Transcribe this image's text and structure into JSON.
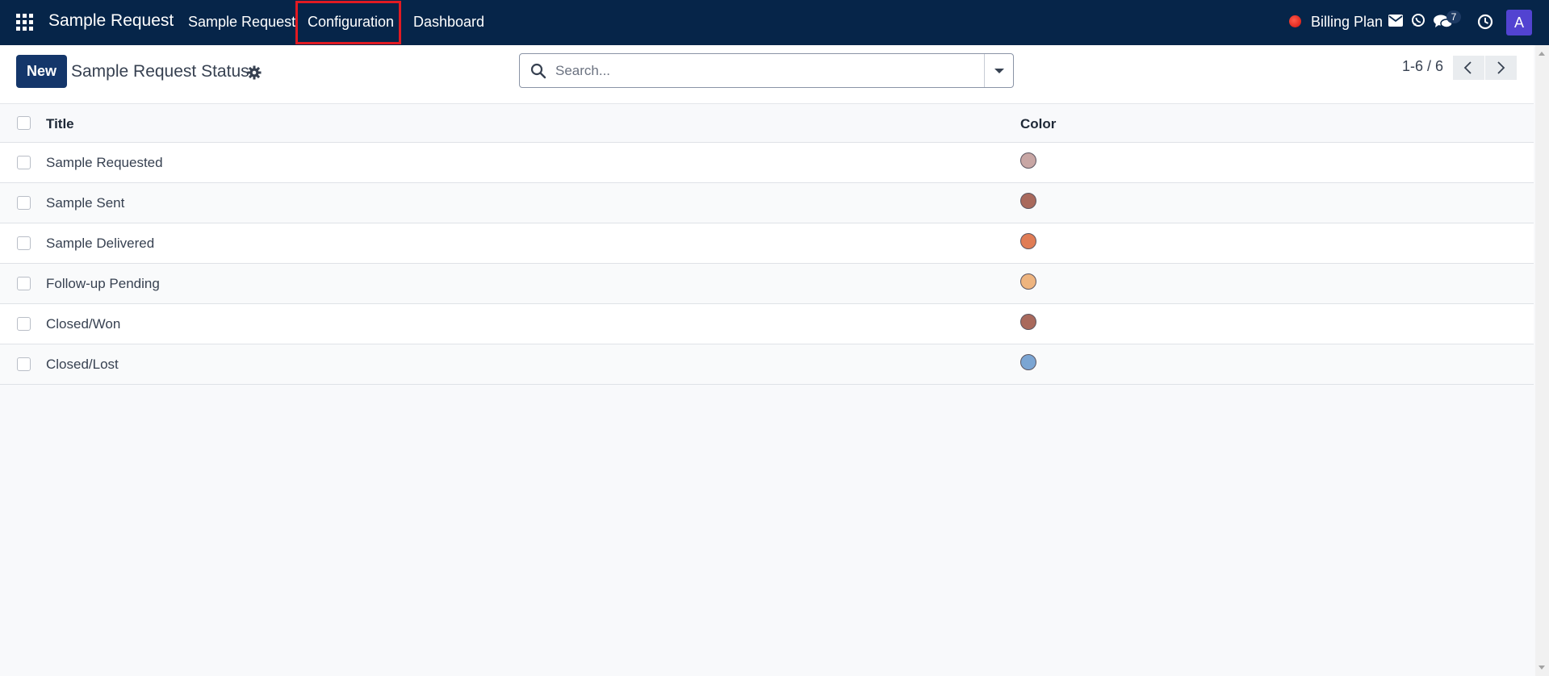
{
  "navbar": {
    "brand": "Sample Request",
    "menu": [
      {
        "label": "Sample Request"
      },
      {
        "label": "Configuration"
      },
      {
        "label": "Dashboard"
      }
    ],
    "highlighted_item": "Configuration",
    "billing_label": "Billing Plan",
    "chat_count": "7",
    "avatar_letter": "A",
    "icons": [
      "apps-grid-icon",
      "status-dot-icon",
      "envelope-icon",
      "whatsapp-icon",
      "chat-icon",
      "clock-icon"
    ]
  },
  "control_panel": {
    "new_button": "New",
    "title": "Sample Request Status",
    "search_placeholder": "Search...",
    "pager": "1-6 / 6"
  },
  "table": {
    "columns": [
      "Title",
      "Color"
    ],
    "rows": [
      {
        "title": "Sample Requested",
        "color": "#c8a6a4"
      },
      {
        "title": "Sample Sent",
        "color": "#a9695c"
      },
      {
        "title": "Sample Delivered",
        "color": "#e07c55"
      },
      {
        "title": "Follow-up Pending",
        "color": "#eeb47f"
      },
      {
        "title": "Closed/Won",
        "color": "#a9695c"
      },
      {
        "title": "Closed/Lost",
        "color": "#7ba5d3"
      }
    ]
  },
  "colors": {
    "navbar_bg": "#062549",
    "primary_button": "#14366a",
    "highlight_border": "#e11a22",
    "avatar_bg": "#5243d1"
  }
}
